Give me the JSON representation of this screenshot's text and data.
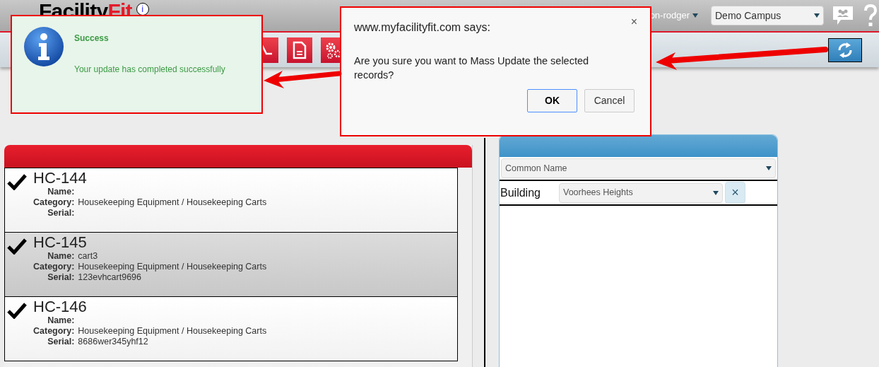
{
  "header": {
    "logo": {
      "text": "Facility",
      "accent": "Fit"
    },
    "info": "i",
    "user": "on-rodger",
    "campus": "Demo Campus"
  },
  "toolbar": {
    "buttons": [
      {
        "kind": "chart"
      },
      {
        "kind": "document"
      },
      {
        "kind": "gears"
      }
    ]
  },
  "notification": {
    "title": "Success",
    "message": "Your update has completed successfully"
  },
  "dialog": {
    "origin": "www.myfacilityfit.com says:",
    "close": "×",
    "message": "Are you sure you want to Mass Update the selected records?",
    "buttons": [
      {
        "label": "OK",
        "selected": true
      },
      {
        "label": "Cancel",
        "selected": false
      }
    ]
  },
  "records": [
    {
      "code": "HC-144",
      "checked": true,
      "selected": false,
      "fields": [
        {
          "label": "Name:"
        },
        {
          "label": "Category:",
          "value": "Housekeeping Equipment / Housekeeping Carts"
        },
        {
          "label": "Serial:"
        }
      ]
    },
    {
      "code": "HC-145",
      "checked": true,
      "selected": true,
      "fields": [
        {
          "label": "Name:",
          "value": "cart3"
        },
        {
          "label": "Category:",
          "value": "Housekeeping Equipment / Housekeeping Carts"
        },
        {
          "label": "Serial:",
          "value": "123evhcart9696"
        }
      ]
    },
    {
      "code": "HC-146",
      "checked": true,
      "selected": false,
      "fields": [
        {
          "label": "Name:"
        },
        {
          "label": "Category:",
          "value": "Housekeeping Equipment / Housekeeping Carts"
        },
        {
          "label": "Serial:",
          "value": "8686wer345yhf12"
        }
      ]
    }
  ],
  "filter": {
    "field": "Common Name",
    "rows": [
      {
        "label": "Building",
        "value": "Voorhees Heights",
        "clear": "×"
      }
    ]
  }
}
